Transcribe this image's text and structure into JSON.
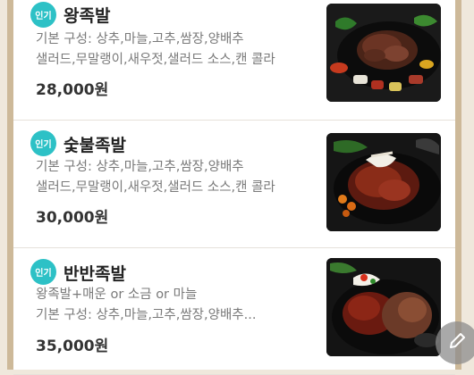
{
  "menu": {
    "items": [
      {
        "badge": "인기",
        "name": "왕족발",
        "desc_line1": "기본 구성: 상추,마늘,고추,쌈장,양배추",
        "desc_line2": "샐러드,무말랭이,새우젓,샐러드 소스,캔 콜라",
        "price": "28,000원",
        "image": "wang-jokbal-photo"
      },
      {
        "badge": "인기",
        "name": "숯불족발",
        "desc_line1": "기본 구성: 상추,마늘,고추,쌈장,양배추",
        "desc_line2": "샐러드,무말랭이,새우젓,샐러드 소스,캔 콜라",
        "price": "30,000원",
        "image": "charcoal-jokbal-photo"
      },
      {
        "badge": "인기",
        "name": "반반족발",
        "desc_line1": "왕족발+매운 or 소금 or 마늘",
        "desc_line2": "기본 구성: 상추,마늘,고추,쌈장,양배추...",
        "price": "35,000원",
        "image": "half-half-jokbal-photo"
      }
    ]
  },
  "fab": {
    "icon": "pencil-icon"
  },
  "colors": {
    "badge": "#2dc1c6",
    "frame_border": "#cdb999",
    "price": "#333333",
    "desc": "#7a7a7a"
  }
}
